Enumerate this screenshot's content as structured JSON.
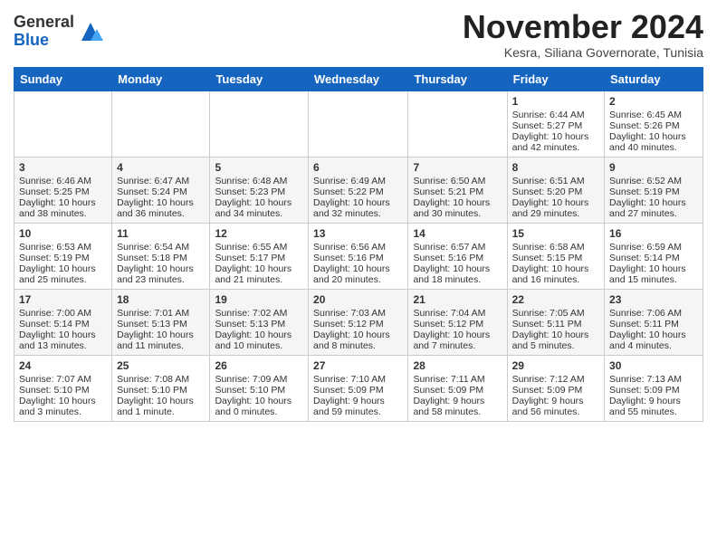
{
  "header": {
    "logo_general": "General",
    "logo_blue": "Blue",
    "month": "November 2024",
    "location": "Kesra, Siliana Governorate, Tunisia"
  },
  "weekdays": [
    "Sunday",
    "Monday",
    "Tuesday",
    "Wednesday",
    "Thursday",
    "Friday",
    "Saturday"
  ],
  "weeks": [
    [
      {
        "day": "",
        "info": ""
      },
      {
        "day": "",
        "info": ""
      },
      {
        "day": "",
        "info": ""
      },
      {
        "day": "",
        "info": ""
      },
      {
        "day": "",
        "info": ""
      },
      {
        "day": "1",
        "info": "Sunrise: 6:44 AM\nSunset: 5:27 PM\nDaylight: 10 hours\nand 42 minutes."
      },
      {
        "day": "2",
        "info": "Sunrise: 6:45 AM\nSunset: 5:26 PM\nDaylight: 10 hours\nand 40 minutes."
      }
    ],
    [
      {
        "day": "3",
        "info": "Sunrise: 6:46 AM\nSunset: 5:25 PM\nDaylight: 10 hours\nand 38 minutes."
      },
      {
        "day": "4",
        "info": "Sunrise: 6:47 AM\nSunset: 5:24 PM\nDaylight: 10 hours\nand 36 minutes."
      },
      {
        "day": "5",
        "info": "Sunrise: 6:48 AM\nSunset: 5:23 PM\nDaylight: 10 hours\nand 34 minutes."
      },
      {
        "day": "6",
        "info": "Sunrise: 6:49 AM\nSunset: 5:22 PM\nDaylight: 10 hours\nand 32 minutes."
      },
      {
        "day": "7",
        "info": "Sunrise: 6:50 AM\nSunset: 5:21 PM\nDaylight: 10 hours\nand 30 minutes."
      },
      {
        "day": "8",
        "info": "Sunrise: 6:51 AM\nSunset: 5:20 PM\nDaylight: 10 hours\nand 29 minutes."
      },
      {
        "day": "9",
        "info": "Sunrise: 6:52 AM\nSunset: 5:19 PM\nDaylight: 10 hours\nand 27 minutes."
      }
    ],
    [
      {
        "day": "10",
        "info": "Sunrise: 6:53 AM\nSunset: 5:19 PM\nDaylight: 10 hours\nand 25 minutes."
      },
      {
        "day": "11",
        "info": "Sunrise: 6:54 AM\nSunset: 5:18 PM\nDaylight: 10 hours\nand 23 minutes."
      },
      {
        "day": "12",
        "info": "Sunrise: 6:55 AM\nSunset: 5:17 PM\nDaylight: 10 hours\nand 21 minutes."
      },
      {
        "day": "13",
        "info": "Sunrise: 6:56 AM\nSunset: 5:16 PM\nDaylight: 10 hours\nand 20 minutes."
      },
      {
        "day": "14",
        "info": "Sunrise: 6:57 AM\nSunset: 5:16 PM\nDaylight: 10 hours\nand 18 minutes."
      },
      {
        "day": "15",
        "info": "Sunrise: 6:58 AM\nSunset: 5:15 PM\nDaylight: 10 hours\nand 16 minutes."
      },
      {
        "day": "16",
        "info": "Sunrise: 6:59 AM\nSunset: 5:14 PM\nDaylight: 10 hours\nand 15 minutes."
      }
    ],
    [
      {
        "day": "17",
        "info": "Sunrise: 7:00 AM\nSunset: 5:14 PM\nDaylight: 10 hours\nand 13 minutes."
      },
      {
        "day": "18",
        "info": "Sunrise: 7:01 AM\nSunset: 5:13 PM\nDaylight: 10 hours\nand 11 minutes."
      },
      {
        "day": "19",
        "info": "Sunrise: 7:02 AM\nSunset: 5:13 PM\nDaylight: 10 hours\nand 10 minutes."
      },
      {
        "day": "20",
        "info": "Sunrise: 7:03 AM\nSunset: 5:12 PM\nDaylight: 10 hours\nand 8 minutes."
      },
      {
        "day": "21",
        "info": "Sunrise: 7:04 AM\nSunset: 5:12 PM\nDaylight: 10 hours\nand 7 minutes."
      },
      {
        "day": "22",
        "info": "Sunrise: 7:05 AM\nSunset: 5:11 PM\nDaylight: 10 hours\nand 5 minutes."
      },
      {
        "day": "23",
        "info": "Sunrise: 7:06 AM\nSunset: 5:11 PM\nDaylight: 10 hours\nand 4 minutes."
      }
    ],
    [
      {
        "day": "24",
        "info": "Sunrise: 7:07 AM\nSunset: 5:10 PM\nDaylight: 10 hours\nand 3 minutes."
      },
      {
        "day": "25",
        "info": "Sunrise: 7:08 AM\nSunset: 5:10 PM\nDaylight: 10 hours\nand 1 minute."
      },
      {
        "day": "26",
        "info": "Sunrise: 7:09 AM\nSunset: 5:10 PM\nDaylight: 10 hours\nand 0 minutes."
      },
      {
        "day": "27",
        "info": "Sunrise: 7:10 AM\nSunset: 5:09 PM\nDaylight: 9 hours\nand 59 minutes."
      },
      {
        "day": "28",
        "info": "Sunrise: 7:11 AM\nSunset: 5:09 PM\nDaylight: 9 hours\nand 58 minutes."
      },
      {
        "day": "29",
        "info": "Sunrise: 7:12 AM\nSunset: 5:09 PM\nDaylight: 9 hours\nand 56 minutes."
      },
      {
        "day": "30",
        "info": "Sunrise: 7:13 AM\nSunset: 5:09 PM\nDaylight: 9 hours\nand 55 minutes."
      }
    ]
  ]
}
